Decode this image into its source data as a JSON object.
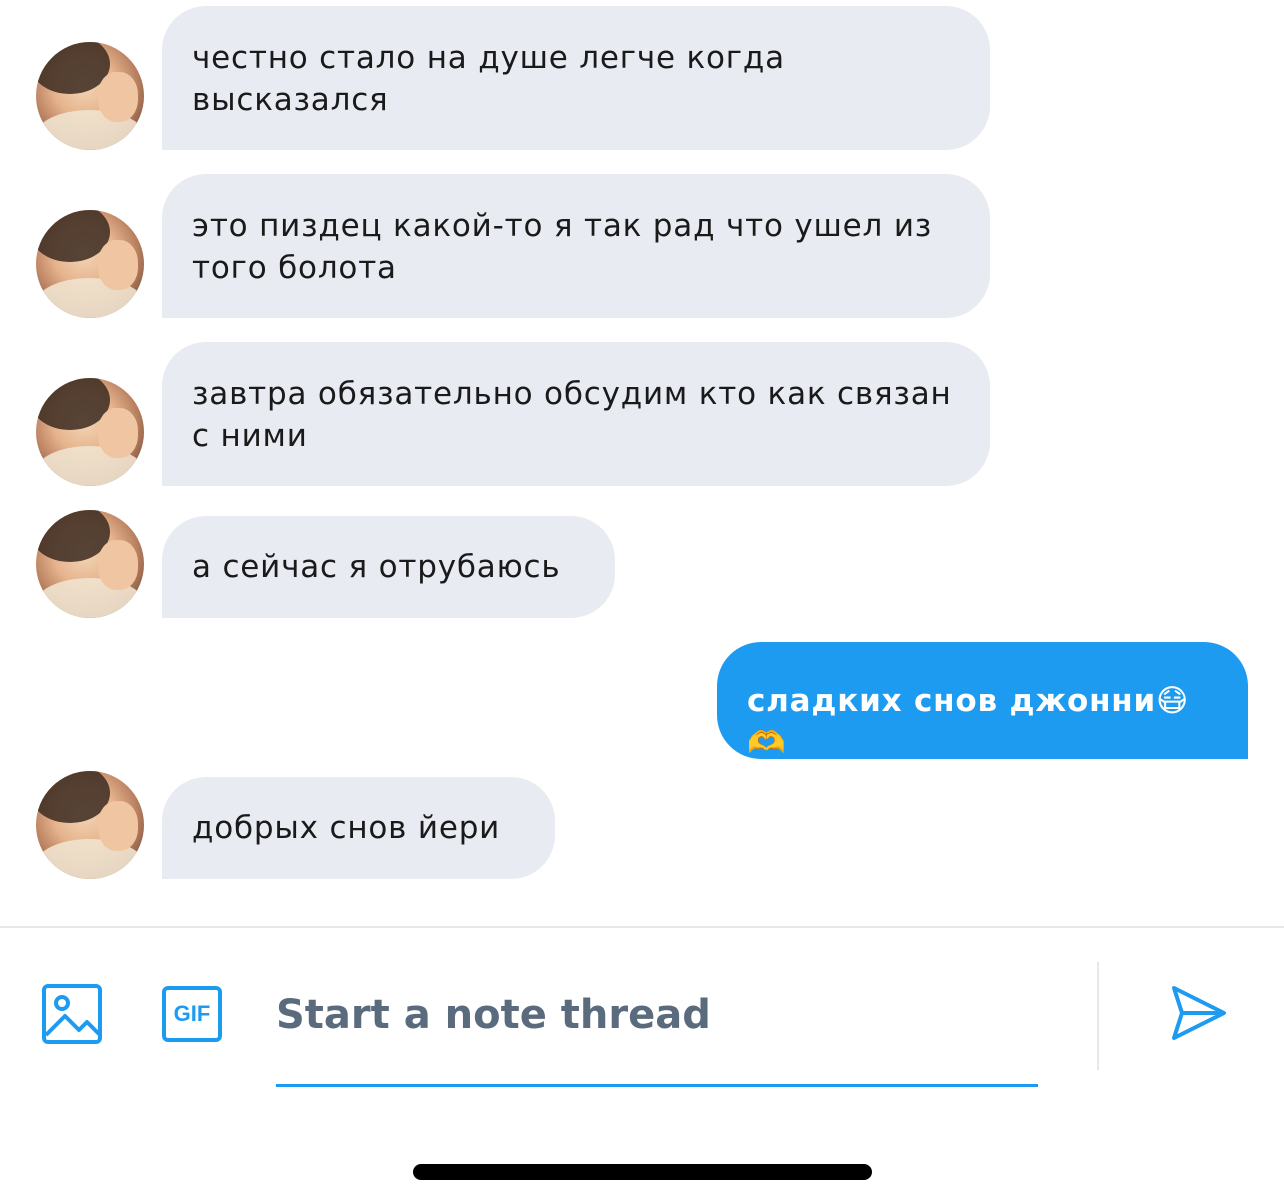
{
  "messages": [
    {
      "direction": "incoming",
      "text": "честно стало на душе легче когда высказался"
    },
    {
      "direction": "incoming",
      "text": "это пиздец какой-то я так рад что ушел из того болота"
    },
    {
      "direction": "incoming",
      "text": "завтра обязательно обсудим кто как связан с ними"
    },
    {
      "direction": "incoming",
      "text": "а сейчас я отрубаюсь"
    },
    {
      "direction": "outgoing",
      "text": "сладких снов джонни😷🫶"
    },
    {
      "direction": "incoming",
      "text": "добрых снов йери"
    }
  ],
  "composer": {
    "gif_label": "GIF",
    "placeholder": "Start a note thread"
  },
  "colors": {
    "accent": "#1d9bf0",
    "incoming_bubble": "#e8ebf1",
    "placeholder_text": "#5b6b7e"
  },
  "icons": [
    "image-icon",
    "gif-icon",
    "send-icon"
  ]
}
